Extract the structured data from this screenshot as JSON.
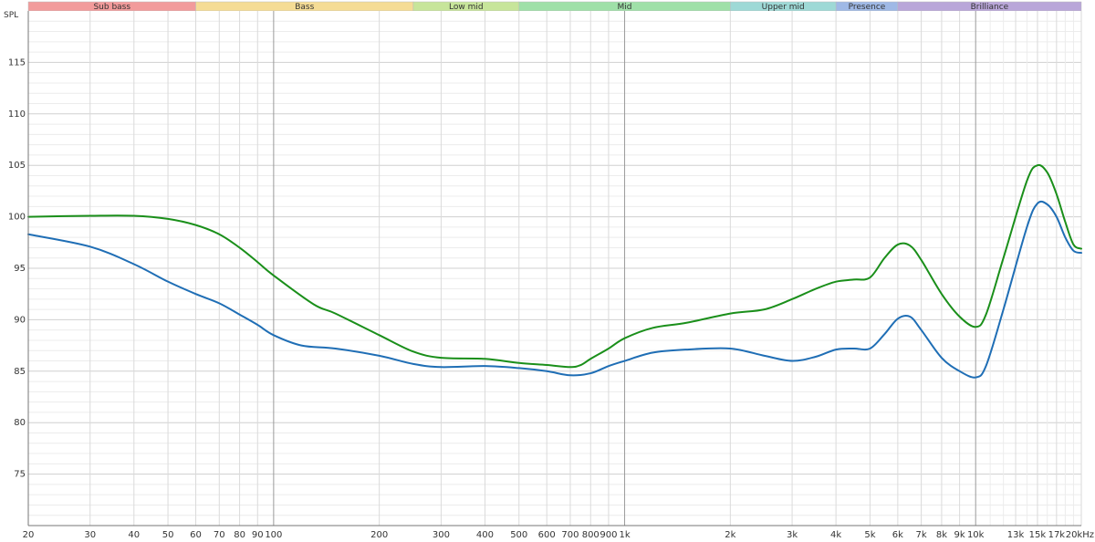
{
  "chart_data": {
    "type": "line",
    "ylabel": "SPL",
    "xunit": "kHz",
    "x_scale": "log",
    "xlim": [
      20,
      20000
    ],
    "ylim": [
      70,
      120
    ],
    "grid": true,
    "y_ticks": [
      75,
      80,
      85,
      90,
      95,
      100,
      105,
      110,
      115
    ],
    "x_ticks": [
      {
        "value": 20,
        "label": "20"
      },
      {
        "value": 30,
        "label": "30"
      },
      {
        "value": 40,
        "label": "40"
      },
      {
        "value": 50,
        "label": "50"
      },
      {
        "value": 60,
        "label": "60"
      },
      {
        "value": 70,
        "label": "70"
      },
      {
        "value": 80,
        "label": "80"
      },
      {
        "value": 90,
        "label": "90"
      },
      {
        "value": 100,
        "label": "100"
      },
      {
        "value": 200,
        "label": "200"
      },
      {
        "value": 300,
        "label": "300"
      },
      {
        "value": 400,
        "label": "400"
      },
      {
        "value": 500,
        "label": "500"
      },
      {
        "value": 600,
        "label": "600"
      },
      {
        "value": 700,
        "label": "700"
      },
      {
        "value": 800,
        "label": "800"
      },
      {
        "value": 900,
        "label": "900"
      },
      {
        "value": 1000,
        "label": "1k"
      },
      {
        "value": 2000,
        "label": "2k"
      },
      {
        "value": 3000,
        "label": "3k"
      },
      {
        "value": 4000,
        "label": "4k"
      },
      {
        "value": 5000,
        "label": "5k"
      },
      {
        "value": 6000,
        "label": "6k"
      },
      {
        "value": 7000,
        "label": "7k"
      },
      {
        "value": 8000,
        "label": "8k"
      },
      {
        "value": 9000,
        "label": "9k"
      },
      {
        "value": 10000,
        "label": "10k"
      },
      {
        "value": 13000,
        "label": "13k"
      },
      {
        "value": 15000,
        "label": "15k"
      },
      {
        "value": 17000,
        "label": "17k"
      },
      {
        "value": 20000,
        "label": "20kHz"
      }
    ],
    "bands": [
      {
        "label": "Sub bass",
        "from": 20,
        "to": 60,
        "color": "#f29b9b"
      },
      {
        "label": "Bass",
        "from": 60,
        "to": 250,
        "color": "#f5dc95"
      },
      {
        "label": "Low mid",
        "from": 250,
        "to": 500,
        "color": "#c7e59a"
      },
      {
        "label": "Mid",
        "from": 500,
        "to": 2000,
        "color": "#9fe0a8"
      },
      {
        "label": "Upper mid",
        "from": 2000,
        "to": 4000,
        "color": "#9ed9d6"
      },
      {
        "label": "Presence",
        "from": 4000,
        "to": 6000,
        "color": "#9fb9e6"
      },
      {
        "label": "Brilliance",
        "from": 6000,
        "to": 20000,
        "color": "#b9a6d9"
      }
    ],
    "series": [
      {
        "color": "#1a8f1a",
        "points": [
          [
            20,
            100
          ],
          [
            30,
            100.1
          ],
          [
            40,
            100.1
          ],
          [
            50,
            99.8
          ],
          [
            60,
            99.2
          ],
          [
            70,
            98.3
          ],
          [
            80,
            97
          ],
          [
            90,
            95.6
          ],
          [
            100,
            94.3
          ],
          [
            130,
            91.5
          ],
          [
            150,
            90.6
          ],
          [
            200,
            88.5
          ],
          [
            250,
            86.9
          ],
          [
            300,
            86.3
          ],
          [
            400,
            86.2
          ],
          [
            500,
            85.8
          ],
          [
            600,
            85.6
          ],
          [
            700,
            85.4
          ],
          [
            750,
            85.6
          ],
          [
            800,
            86.2
          ],
          [
            900,
            87.2
          ],
          [
            1000,
            88.2
          ],
          [
            1200,
            89.2
          ],
          [
            1500,
            89.7
          ],
          [
            2000,
            90.6
          ],
          [
            2500,
            91
          ],
          [
            3000,
            92
          ],
          [
            3500,
            93
          ],
          [
            4000,
            93.7
          ],
          [
            4500,
            93.9
          ],
          [
            5000,
            94.1
          ],
          [
            5500,
            96
          ],
          [
            6000,
            97.3
          ],
          [
            6500,
            97.2
          ],
          [
            7000,
            95.8
          ],
          [
            8000,
            92.5
          ],
          [
            9000,
            90.3
          ],
          [
            10000,
            89.3
          ],
          [
            10700,
            90.5
          ],
          [
            12000,
            96
          ],
          [
            14000,
            103.5
          ],
          [
            15000,
            105
          ],
          [
            16000,
            104.3
          ],
          [
            17000,
            102.2
          ],
          [
            18000,
            99.5
          ],
          [
            19000,
            97.3
          ],
          [
            20000,
            96.9
          ]
        ]
      },
      {
        "color": "#1f6eb5",
        "points": [
          [
            20,
            98.3
          ],
          [
            30,
            97.1
          ],
          [
            40,
            95.4
          ],
          [
            50,
            93.7
          ],
          [
            60,
            92.5
          ],
          [
            70,
            91.6
          ],
          [
            80,
            90.5
          ],
          [
            90,
            89.5
          ],
          [
            100,
            88.5
          ],
          [
            120,
            87.5
          ],
          [
            150,
            87.2
          ],
          [
            200,
            86.5
          ],
          [
            250,
            85.7
          ],
          [
            300,
            85.4
          ],
          [
            400,
            85.5
          ],
          [
            500,
            85.3
          ],
          [
            600,
            85
          ],
          [
            700,
            84.6
          ],
          [
            800,
            84.8
          ],
          [
            900,
            85.5
          ],
          [
            1000,
            86
          ],
          [
            1200,
            86.8
          ],
          [
            1500,
            87.1
          ],
          [
            2000,
            87.2
          ],
          [
            2500,
            86.5
          ],
          [
            3000,
            86
          ],
          [
            3500,
            86.4
          ],
          [
            4000,
            87.1
          ],
          [
            4500,
            87.2
          ],
          [
            5000,
            87.2
          ],
          [
            5500,
            88.6
          ],
          [
            6000,
            90.1
          ],
          [
            6500,
            90.3
          ],
          [
            7000,
            89
          ],
          [
            8000,
            86.3
          ],
          [
            9000,
            85
          ],
          [
            10000,
            84.4
          ],
          [
            10700,
            85.5
          ],
          [
            12000,
            91
          ],
          [
            14000,
            99
          ],
          [
            15000,
            101.3
          ],
          [
            16000,
            101.2
          ],
          [
            17000,
            100
          ],
          [
            18000,
            98
          ],
          [
            19000,
            96.7
          ],
          [
            20000,
            96.5
          ]
        ]
      }
    ]
  }
}
